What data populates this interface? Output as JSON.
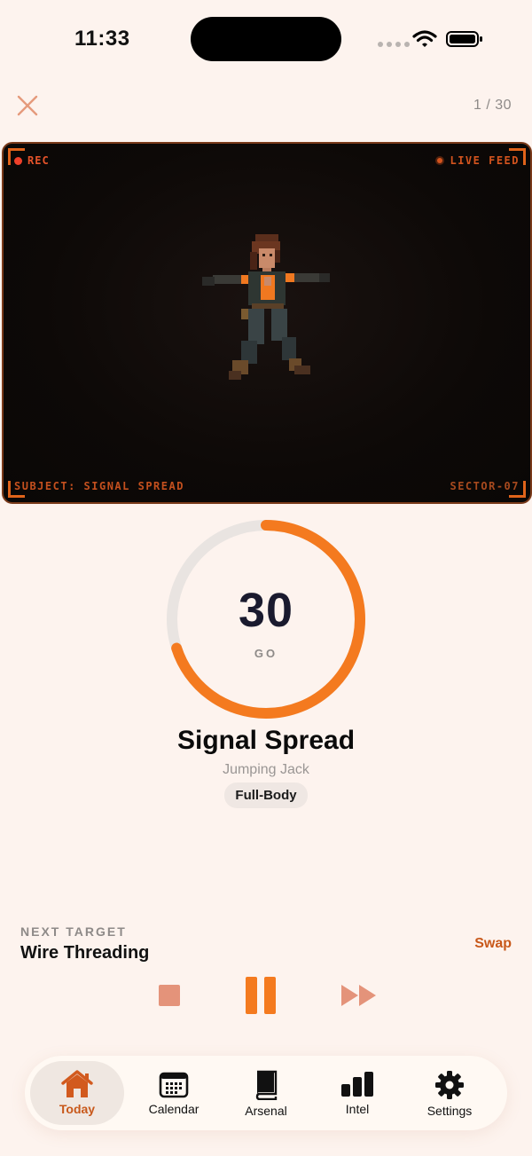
{
  "status_bar": {
    "time": "11:33"
  },
  "header": {
    "counter": "1 / 30"
  },
  "feed": {
    "rec_label": "REC",
    "live_label": "LIVE FEED",
    "subject_label": "SUBJECT: SIGNAL SPREAD",
    "sector_label": "SECTOR-07"
  },
  "timer": {
    "value": "30",
    "state": "GO",
    "progress_fraction": 0.7
  },
  "exercise": {
    "name": "Signal Spread",
    "subtitle": "Jumping Jack",
    "tag": "Full-Body"
  },
  "next": {
    "label": "NEXT TARGET",
    "name": "Wire Threading",
    "swap_label": "Swap"
  },
  "tabs": [
    {
      "label": "Today",
      "icon": "home-icon",
      "active": true
    },
    {
      "label": "Calendar",
      "icon": "calendar-icon",
      "active": false
    },
    {
      "label": "Arsenal",
      "icon": "book-icon",
      "active": false
    },
    {
      "label": "Intel",
      "icon": "bar-chart-icon",
      "active": false
    },
    {
      "label": "Settings",
      "icon": "gear-icon",
      "active": false
    }
  ],
  "colors": {
    "accent": "#F47A1F",
    "accent_text": "#C8581A",
    "background": "#FDF3EE",
    "ring_track": "#E9E4E1"
  }
}
